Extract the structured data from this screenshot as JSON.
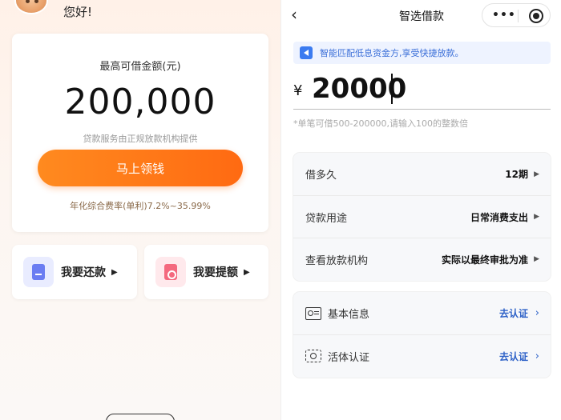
{
  "home": {
    "greeting": "您好!",
    "amount_label": "最高可借金额(元)",
    "amount_value": "200,000",
    "amount_note": "贷款服务由正规放款机构提供",
    "apply_button": "马上领钱",
    "rate_text": "年化综合费率(单利)7.2%~35.99%",
    "quick_actions": [
      {
        "label": "我要还款",
        "icon": "repay-icon",
        "color": "#6b7df2"
      },
      {
        "label": "我要提额",
        "icon": "raise-limit-icon",
        "color": "#f4697e"
      }
    ]
  },
  "loan": {
    "title": "智选借款",
    "notice": "智能匹配低息资金方,享受快捷放款。",
    "currency_symbol": "¥",
    "amount_input": "20000",
    "hint": "*单笔可借500-200000,请输入100的整数倍",
    "terms": [
      {
        "label": "借多久",
        "value": "12期"
      },
      {
        "label": "贷款用途",
        "value": "日常消费支出"
      },
      {
        "label": "查看放款机构",
        "value": "实际以最终审批为准"
      }
    ],
    "verification": [
      {
        "label": "基本信息",
        "action": "去认证",
        "icon": "id-card-icon"
      },
      {
        "label": "活体认证",
        "action": "去认证",
        "icon": "face-scan-icon"
      }
    ]
  },
  "colors": {
    "accent_orange": "#ff7a19",
    "link_blue": "#2d61c7",
    "notice_bg": "#eef3ff"
  }
}
